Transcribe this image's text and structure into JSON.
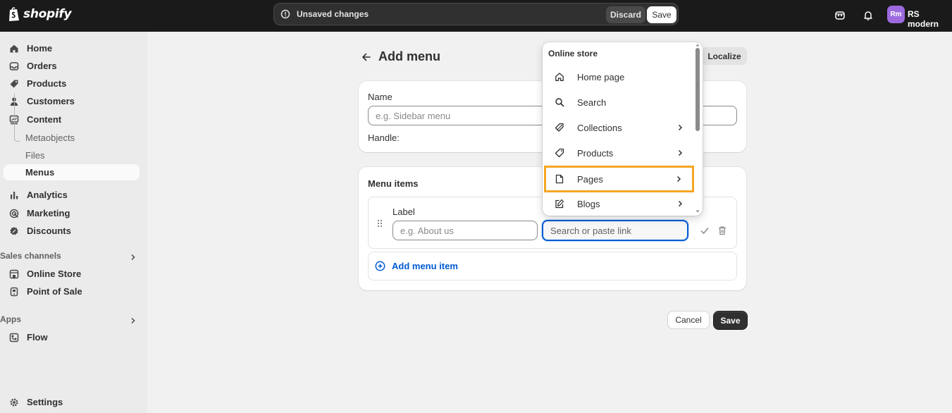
{
  "topbar": {
    "brand": "shopify",
    "unsaved_text": "Unsaved changes",
    "discard_label": "Discard",
    "save_label": "Save",
    "avatar_initials": "Rm",
    "store_name": "RS modern"
  },
  "sidebar": {
    "items": [
      {
        "label": "Home",
        "icon": "home-icon"
      },
      {
        "label": "Orders",
        "icon": "orders-icon"
      },
      {
        "label": "Products",
        "icon": "tag-icon"
      },
      {
        "label": "Customers",
        "icon": "person-icon"
      },
      {
        "label": "Content",
        "icon": "content-icon"
      }
    ],
    "content_sub": [
      "Metaobjects",
      "Files",
      "Menus"
    ],
    "items2": [
      {
        "label": "Analytics",
        "icon": "chart-icon"
      },
      {
        "label": "Marketing",
        "icon": "target-icon"
      },
      {
        "label": "Discounts",
        "icon": "discount-icon"
      }
    ],
    "sales_channels_label": "Sales channels",
    "channels": [
      {
        "label": "Online Store",
        "icon": "store-icon"
      },
      {
        "label": "Point of Sale",
        "icon": "pos-icon"
      }
    ],
    "apps_label": "Apps",
    "apps": [
      {
        "label": "Flow",
        "icon": "flow-icon"
      }
    ],
    "settings_label": "Settings"
  },
  "main": {
    "page_title": "Add menu",
    "localize_label": "Localize",
    "name_label": "Name",
    "name_placeholder": "e.g. Sidebar menu",
    "handle_label": "Handle:",
    "menu_items_heading": "Menu items",
    "item_label_label": "Label",
    "item_label_placeholder": "e.g. About us",
    "link_placeholder": "Search or paste link",
    "add_menu_item_label": "Add menu item",
    "cancel_label": "Cancel",
    "save_label": "Save"
  },
  "dropdown": {
    "title": "Online store",
    "items": [
      {
        "label": "Home page",
        "icon": "home-icon",
        "has_submenu": false
      },
      {
        "label": "Search",
        "icon": "search-icon",
        "has_submenu": false
      },
      {
        "label": "Collections",
        "icon": "collection-tag-icon",
        "has_submenu": true
      },
      {
        "label": "Products",
        "icon": "tag-icon",
        "has_submenu": true
      },
      {
        "label": "Pages",
        "icon": "page-icon",
        "has_submenu": true,
        "highlighted": true
      },
      {
        "label": "Blogs",
        "icon": "blog-icon",
        "has_submenu": true
      }
    ]
  },
  "colors": {
    "topbar": "#1a1a1a",
    "accent_blue": "#005bd3",
    "highlight": "#f5a623",
    "avatar": "#9c6ade"
  }
}
